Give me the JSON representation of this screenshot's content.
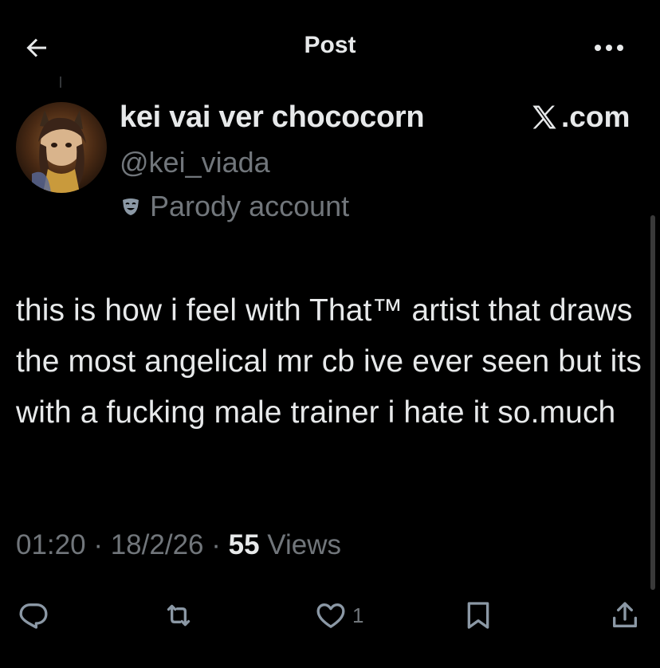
{
  "header": {
    "title": "Post",
    "back_icon": "arrow-left-icon",
    "more_icon": "more-horizontal-icon"
  },
  "author": {
    "display_name": "kei vai ver chococorn",
    "handle": "@kei_viada",
    "badge_label": "Parody account",
    "badge_icon": "parody-mask-icon"
  },
  "watermark": {
    "text": ".com"
  },
  "tweet": {
    "text": "this is how i feel with That™ artist that draws the most angelical mr cb ive ever seen but its with a fucking male trainer i hate it so.much"
  },
  "meta": {
    "time": "01:20",
    "separator": "·",
    "date": "18/2/26",
    "views_count": "55",
    "views_label": "Views"
  },
  "actions": {
    "reply_icon": "reply-icon",
    "repost_icon": "repost-icon",
    "like_icon": "heart-icon",
    "like_count": "1",
    "bookmark_icon": "bookmark-icon",
    "share_icon": "share-icon"
  },
  "colors": {
    "background": "#000000",
    "primary_text": "#e7e9ea",
    "secondary_text": "#71767b"
  }
}
